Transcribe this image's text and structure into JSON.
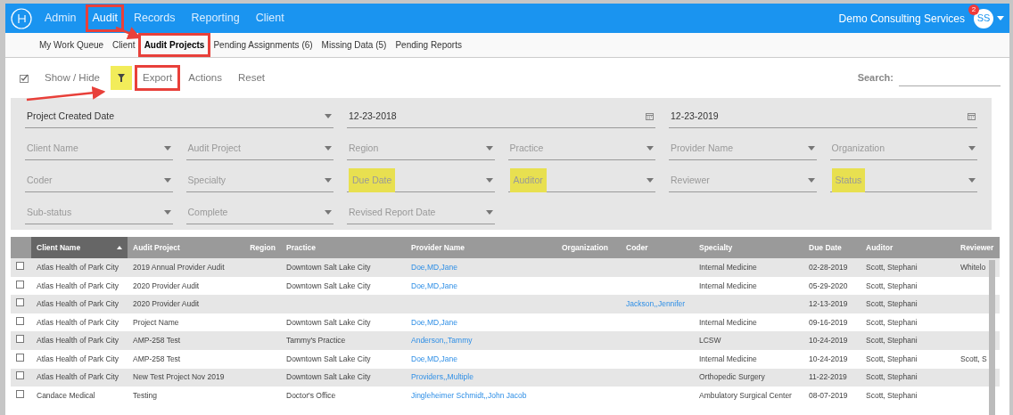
{
  "navbar": {
    "items": [
      {
        "label": "Admin",
        "selected": false,
        "annotated": false
      },
      {
        "label": "Audit",
        "selected": true,
        "annotated": true
      },
      {
        "label": "Records",
        "selected": false,
        "annotated": false
      },
      {
        "label": "Reporting",
        "selected": false,
        "annotated": false
      },
      {
        "label": "Client",
        "selected": false,
        "annotated": false
      }
    ],
    "company": "Demo Consulting Services",
    "avatar": {
      "initials": "SS",
      "badge": "2"
    }
  },
  "subnav": {
    "items": [
      {
        "label": "My Work Queue",
        "selected": false,
        "annotated": false
      },
      {
        "label": "Client",
        "selected": false,
        "annotated": false
      },
      {
        "label": "Audit Projects",
        "selected": true,
        "annotated": true
      },
      {
        "label": "Pending Assignments (6)",
        "selected": false,
        "annotated": false
      },
      {
        "label": "Missing Data (5)",
        "selected": false,
        "annotated": false
      },
      {
        "label": "Pending Reports",
        "selected": false,
        "annotated": false
      }
    ]
  },
  "toolbar": {
    "items": [
      {
        "kind": "check",
        "highlighted": false,
        "annotated": false
      },
      {
        "kind": "text",
        "label": "Show / Hide",
        "highlighted": false,
        "annotated": false
      },
      {
        "kind": "filter",
        "highlighted": true,
        "annotated": false
      },
      {
        "kind": "text",
        "label": "Export",
        "highlighted": false,
        "annotated": true
      },
      {
        "kind": "text",
        "label": "Actions",
        "highlighted": false,
        "annotated": false
      },
      {
        "kind": "text",
        "label": "Reset",
        "highlighted": false,
        "annotated": false
      }
    ],
    "search_label": "Search:"
  },
  "filters": [
    {
      "kind": "range_select",
      "value": "Project Created Date",
      "highlighted": false
    },
    {
      "kind": "date",
      "value": "12-23-2018",
      "highlighted": false
    },
    {
      "kind": "date",
      "value": "12-23-2019",
      "highlighted": false
    },
    {
      "kind": "select",
      "placeholder": "Client Name",
      "highlighted": false
    },
    {
      "kind": "select",
      "placeholder": "Audit Project",
      "highlighted": false
    },
    {
      "kind": "select",
      "placeholder": "Region",
      "highlighted": false
    },
    {
      "kind": "select",
      "placeholder": "Practice",
      "highlighted": false
    },
    {
      "kind": "select",
      "placeholder": "Provider Name",
      "highlighted": false
    },
    {
      "kind": "select",
      "placeholder": "Organization",
      "highlighted": false
    },
    {
      "kind": "select",
      "placeholder": "Coder",
      "highlighted": false
    },
    {
      "kind": "select",
      "placeholder": "Specialty",
      "highlighted": false
    },
    {
      "kind": "select",
      "placeholder": "Due Date",
      "highlighted": true
    },
    {
      "kind": "select",
      "placeholder": "Auditor",
      "highlighted": true
    },
    {
      "kind": "select",
      "placeholder": "Reviewer",
      "highlighted": false
    },
    {
      "kind": "select",
      "placeholder": "Status",
      "highlighted": true
    },
    {
      "kind": "select",
      "placeholder": "Sub-status",
      "highlighted": false
    },
    {
      "kind": "select",
      "placeholder": "Complete",
      "highlighted": false
    },
    {
      "kind": "select",
      "placeholder": "Revised Report Date",
      "highlighted": false
    }
  ],
  "table": {
    "columns": [
      {
        "label": "Client Name",
        "sorted": true,
        "kind": "text"
      },
      {
        "label": "Audit Project",
        "sorted": false,
        "kind": "text"
      },
      {
        "label": "Region",
        "sorted": false,
        "kind": "text"
      },
      {
        "label": "Practice",
        "sorted": false,
        "kind": "text"
      },
      {
        "label": "Provider Name",
        "sorted": false,
        "kind": "link"
      },
      {
        "label": "Organization",
        "sorted": false,
        "kind": "text"
      },
      {
        "label": "Coder",
        "sorted": false,
        "kind": "link"
      },
      {
        "label": "Specialty",
        "sorted": false,
        "kind": "text"
      },
      {
        "label": "Due Date",
        "sorted": false,
        "kind": "text"
      },
      {
        "label": "Auditor",
        "sorted": false,
        "kind": "text"
      },
      {
        "label": "Reviewer",
        "sorted": false,
        "kind": "text"
      }
    ],
    "rows": [
      {
        "checked": false,
        "cells": [
          "Atlas Health of Park City",
          "2019 Annual Provider Audit",
          "",
          "Downtown Salt Lake City",
          "Doe,MD,Jane",
          "",
          "",
          "Internal Medicine",
          "02-28-2019",
          "Scott, Stephani",
          "Whitelo"
        ]
      },
      {
        "checked": false,
        "cells": [
          "Atlas Health of Park City",
          "2020 Provider Audit",
          "",
          "Downtown Salt Lake City",
          "Doe,MD,Jane",
          "",
          "",
          "Internal Medicine",
          "05-29-2020",
          "Scott, Stephani",
          ""
        ]
      },
      {
        "checked": false,
        "cells": [
          "Atlas Health of Park City",
          "2020 Provider Audit",
          "",
          "",
          "",
          "",
          "Jackson,,Jennifer",
          "",
          "12-13-2019",
          "Scott, Stephani",
          ""
        ]
      },
      {
        "checked": false,
        "cells": [
          "Atlas Health of Park City",
          "Project Name",
          "",
          "Downtown Salt Lake City",
          "Doe,MD,Jane",
          "",
          "",
          "Internal Medicine",
          "09-16-2019",
          "Scott, Stephani",
          ""
        ]
      },
      {
        "checked": false,
        "cells": [
          "Atlas Health of Park City",
          "AMP-258 Test",
          "",
          "Tammy's Practice",
          "Anderson,,Tammy",
          "",
          "",
          "LCSW",
          "10-24-2019",
          "Scott, Stephani",
          ""
        ]
      },
      {
        "checked": false,
        "cells": [
          "Atlas Health of Park City",
          "AMP-258 Test",
          "",
          "Downtown Salt Lake City",
          "Doe,MD,Jane",
          "",
          "",
          "Internal Medicine",
          "10-24-2019",
          "Scott, Stephani",
          "Scott, S"
        ]
      },
      {
        "checked": false,
        "cells": [
          "Atlas Health of Park City",
          "New Test Project Nov 2019",
          "",
          "Downtown Salt Lake City",
          "Providers,,Multiple",
          "",
          "",
          "Orthopedic Surgery",
          "11-22-2019",
          "Scott, Stephani",
          ""
        ]
      },
      {
        "checked": false,
        "cells": [
          "Candace Medical",
          "Testing",
          "",
          "Doctor's Office",
          "Jingleheimer Schmidt,,John Jacob",
          "",
          "",
          "Ambulatory Surgical Center",
          "08-07-2019",
          "Scott, Stephani",
          ""
        ]
      }
    ]
  }
}
